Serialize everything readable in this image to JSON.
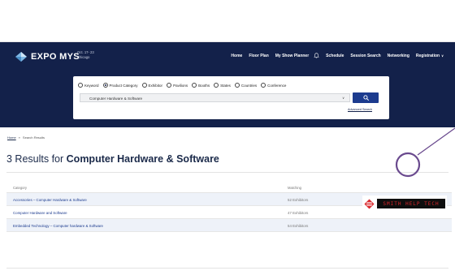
{
  "brand": {
    "logo_text": "EXPO MYS",
    "event_dates": "Oct. 17- 23",
    "event_city": "Chicago",
    "navy": "#13214a",
    "accent": "#1c3b8e"
  },
  "nav": {
    "links": [
      "Home",
      "Floor Plan",
      "My Show Planner",
      "Schedule",
      "Session Search",
      "Networking",
      "Registration"
    ]
  },
  "search": {
    "options": [
      "Keyword",
      "Product Category",
      "Exhibitor",
      "Pavilions",
      "Booths",
      "States",
      "Countries",
      "Conference"
    ],
    "selected_option": "Product Category",
    "selected_value": "Computer Hardware & Software",
    "advanced_link": "Advanced Search",
    "button_icon": "search-icon"
  },
  "breadcrumb": {
    "home": "Home",
    "sep": "»",
    "current": "Search Results"
  },
  "results": {
    "title_prefix": "3 Results for",
    "title_query": "Computer Hardware & Software",
    "columns": {
      "category": "Category",
      "matching": "Matching"
    },
    "rows": [
      {
        "category": "Accessories – Computer Hardware & Software",
        "matching": "52 Exhibitors"
      },
      {
        "category": "Computer Hardware and Software",
        "matching": "47 Exhibitors"
      },
      {
        "category": "Embedded Technology – Computer hardware & Software",
        "matching": "54 Exhibitors"
      }
    ]
  },
  "sponsor": {
    "name": "SMITH HELP TECH"
  },
  "icons": {
    "logo": "diamond-logo-icon",
    "bell": "bell-icon",
    "chevron": "chevron-down-icon"
  }
}
